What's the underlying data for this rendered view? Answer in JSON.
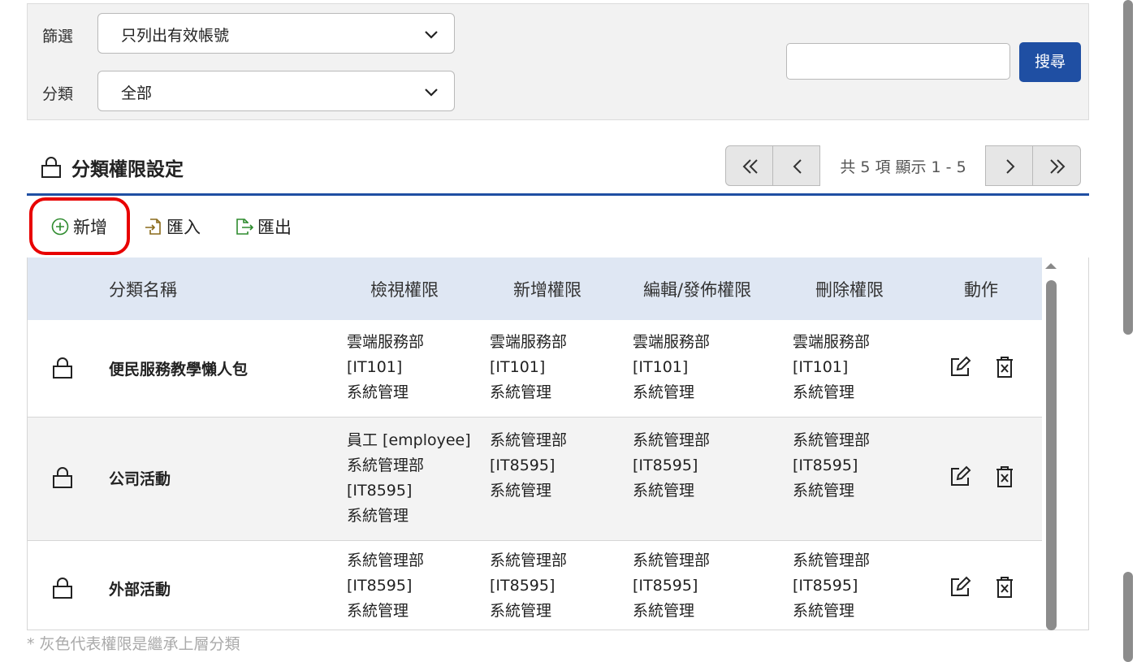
{
  "filters": {
    "filter_label": "篩選",
    "filter_value": "只列出有效帳號",
    "category_label": "分類",
    "category_value": "全部",
    "search_value": "",
    "search_button": "搜尋"
  },
  "section": {
    "title": "分類權限設定"
  },
  "pager": {
    "info": "共 5 項 顯示 1 - 5"
  },
  "toolbar": {
    "add_label": "新增",
    "import_label": "匯入",
    "export_label": "匯出"
  },
  "table": {
    "headers": [
      "分類名稱",
      "檢視權限",
      "新增權限",
      "編輯/發佈權限",
      "刪除權限",
      "動作"
    ],
    "rows": [
      {
        "name": "便民服務教學懶人包",
        "view": [
          "雲端服務部",
          "[IT101]",
          "系統管理"
        ],
        "add": [
          "雲端服務部",
          "[IT101]",
          "系統管理"
        ],
        "edit": [
          "雲端服務部",
          "[IT101]",
          "系統管理"
        ],
        "delete": [
          "雲端服務部",
          "[IT101]",
          "系統管理"
        ]
      },
      {
        "name": "公司活動",
        "view": [
          "員工 [employee]",
          "系統管理部",
          "[IT8595]",
          "系統管理"
        ],
        "add": [
          "系統管理部",
          "[IT8595]",
          "系統管理"
        ],
        "edit": [
          "系統管理部",
          "[IT8595]",
          "系統管理"
        ],
        "delete": [
          "系統管理部",
          "[IT8595]",
          "系統管理"
        ]
      },
      {
        "name": "外部活動",
        "view": [
          "系統管理部",
          "[IT8595]",
          "系統管理"
        ],
        "add": [
          "系統管理部",
          "[IT8595]",
          "系統管理"
        ],
        "edit": [
          "系統管理部",
          "[IT8595]",
          "系統管理"
        ],
        "delete": [
          "系統管理部",
          "[IT8595]",
          "系統管理"
        ]
      }
    ]
  },
  "footnote": "* 灰色代表權限是繼承上層分類",
  "colors": {
    "accent": "#1f4fa3",
    "header_bg": "#dfe7f3",
    "highlight": "#e80000"
  },
  "icons": [
    "chevron-down-icon",
    "lock-icon",
    "first-page-icon",
    "prev-page-icon",
    "next-page-icon",
    "last-page-icon",
    "add-circle-icon",
    "import-icon",
    "export-icon",
    "edit-icon",
    "delete-icon"
  ]
}
